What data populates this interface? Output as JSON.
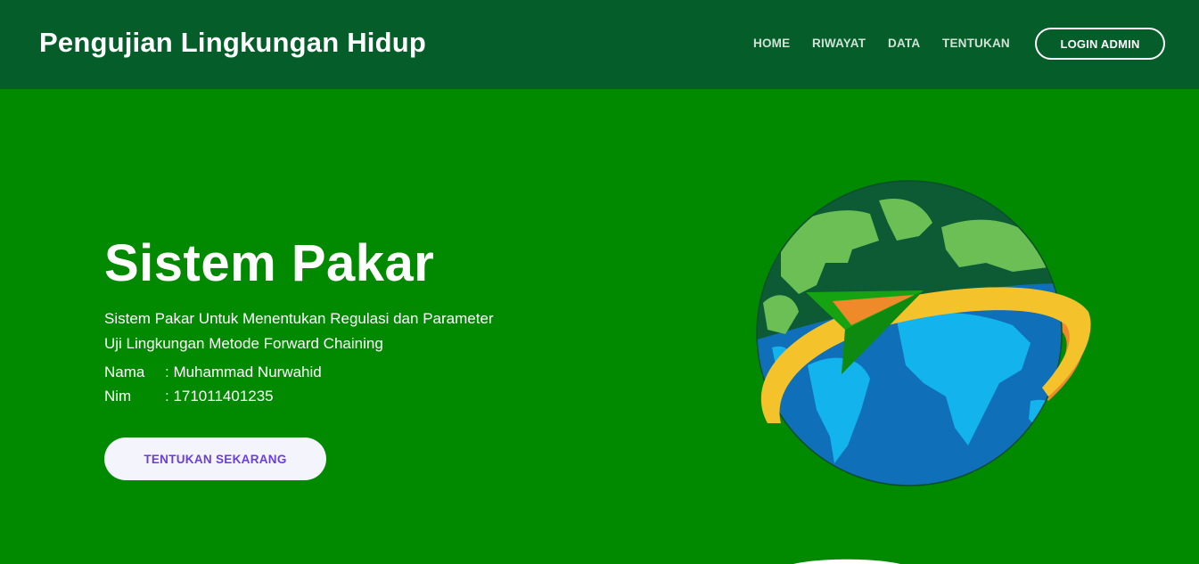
{
  "header": {
    "brand": "Pengujian Lingkungan Hidup",
    "nav": {
      "home": "HOME",
      "riwayat": "RIWAYAT",
      "data": "DATA",
      "tentukan": "TENTUKAN"
    },
    "login_label": "LOGIN ADMIN"
  },
  "hero": {
    "title": "Sistem Pakar",
    "description": "Sistem Pakar Untuk Menentukan Regulasi dan Parameter Uji Lingkungan Metode Forward Chaining",
    "nama_label": "Nama",
    "nama_value": ": Muhammad Nurwahid",
    "nim_label": "Nim",
    "nim_value": ": 171011401235",
    "cta_label": "TENTUKAN SEKARANG"
  },
  "illustration": {
    "icon": "globe-with-paper-plane-icon"
  },
  "colors": {
    "navbar": "#055d2a",
    "hero_bg": "#018a00",
    "cta_bg": "#f4f5fc",
    "cta_text": "#6a3fd8"
  }
}
